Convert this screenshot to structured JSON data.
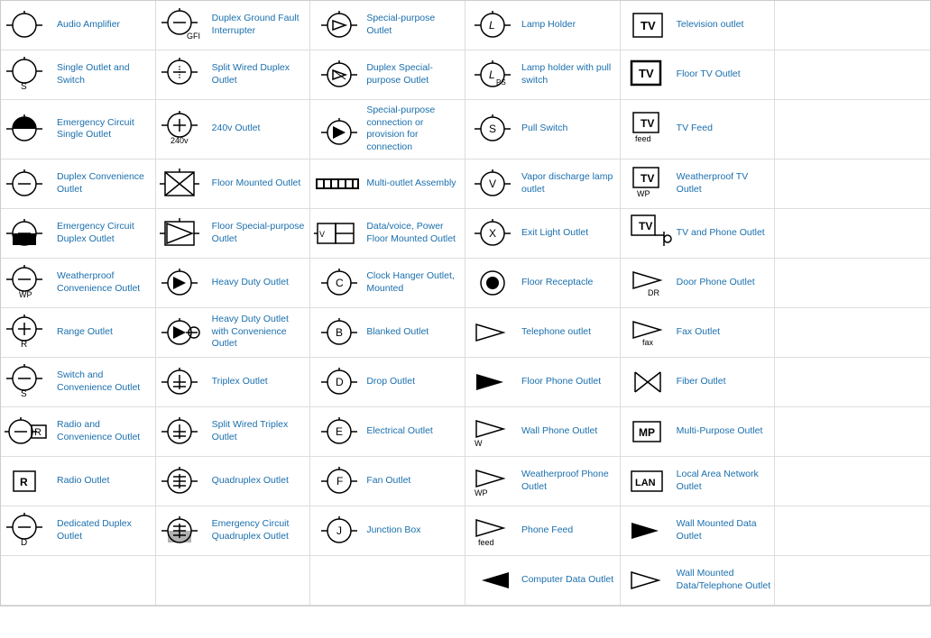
{
  "items": [
    {
      "id": "audio-amplifier",
      "label": "Audio Amplifier",
      "col": 1
    },
    {
      "id": "duplex-gfi",
      "label": "Duplex Ground Fault Interrupter",
      "col": 2
    },
    {
      "id": "special-purpose-outlet",
      "label": "Special-purpose Outlet",
      "col": 3
    },
    {
      "id": "lamp-holder",
      "label": "Lamp Holder",
      "col": 4
    },
    {
      "id": "television-outlet",
      "label": "Television outlet",
      "col": 5
    },
    {
      "id": "blank6",
      "label": "",
      "col": 6
    },
    {
      "id": "single-outlet-switch",
      "label": "Single Outlet and Switch",
      "col": 1
    },
    {
      "id": "split-wired-duplex",
      "label": "Split Wired Duplex Outlet",
      "col": 2
    },
    {
      "id": "duplex-special-purpose",
      "label": "Duplex Special-purpose Outlet",
      "col": 3
    },
    {
      "id": "lamp-holder-pull",
      "label": "Lamp holder with pull switch",
      "col": 4
    },
    {
      "id": "floor-tv-outlet",
      "label": "Floor TV Outlet",
      "col": 5
    },
    {
      "id": "blank12",
      "label": "",
      "col": 6
    },
    {
      "id": "emergency-single",
      "label": "Emergency Circuit Single Outlet",
      "col": 1
    },
    {
      "id": "240v-outlet",
      "label": "240v Outlet",
      "col": 2
    },
    {
      "id": "special-purpose-connection",
      "label": "Special-purpose connection or provision for connection",
      "col": 3
    },
    {
      "id": "pull-switch",
      "label": "Pull Switch",
      "col": 4
    },
    {
      "id": "tv-feed",
      "label": "TV Feed",
      "col": 5
    },
    {
      "id": "blank18",
      "label": "",
      "col": 6
    },
    {
      "id": "duplex-convenience",
      "label": "Duplex Convenience Outlet",
      "col": 1
    },
    {
      "id": "floor-mounted",
      "label": "Floor Mounted Outlet",
      "col": 2
    },
    {
      "id": "multi-outlet-assembly",
      "label": "Multi-outlet Assembly",
      "col": 3
    },
    {
      "id": "vapor-discharge",
      "label": "Vapor discharge lamp outlet",
      "col": 4
    },
    {
      "id": "weatherproof-tv",
      "label": "Weatherproof TV Outlet",
      "col": 5
    },
    {
      "id": "blank24",
      "label": "",
      "col": 6
    },
    {
      "id": "emergency-duplex",
      "label": "Emergency Circuit Duplex Outlet",
      "col": 1
    },
    {
      "id": "floor-special-purpose",
      "label": "Floor Special-purpose Outlet",
      "col": 2
    },
    {
      "id": "data-voice-power",
      "label": "Data/voice, Power Floor Mounted Outlet",
      "col": 3
    },
    {
      "id": "exit-light",
      "label": "Exit Light Outlet",
      "col": 4
    },
    {
      "id": "tv-phone",
      "label": "TV and Phone Outlet",
      "col": 5
    },
    {
      "id": "blank30",
      "label": "",
      "col": 6
    },
    {
      "id": "weatherproof-convenience",
      "label": "Weatherproof Convenience Outlet",
      "col": 1
    },
    {
      "id": "heavy-duty",
      "label": "Heavy Duty Outlet",
      "col": 2
    },
    {
      "id": "clock-hanger",
      "label": "Clock Hanger Outlet, Mounted",
      "col": 3
    },
    {
      "id": "floor-receptacle",
      "label": "Floor Receptacle",
      "col": 4
    },
    {
      "id": "door-phone",
      "label": "Door Phone Outlet",
      "col": 5
    },
    {
      "id": "blank36",
      "label": "",
      "col": 6
    },
    {
      "id": "range-outlet",
      "label": "Range Outlet",
      "col": 1
    },
    {
      "id": "heavy-duty-convenience",
      "label": "Heavy Duty Outlet with Convenience Outlet",
      "col": 2
    },
    {
      "id": "blanked-outlet",
      "label": "Blanked Outlet",
      "col": 3
    },
    {
      "id": "telephone-outlet",
      "label": "Telephone outlet",
      "col": 4
    },
    {
      "id": "fax-outlet",
      "label": "Fax Outlet",
      "col": 5
    },
    {
      "id": "blank42",
      "label": "",
      "col": 6
    },
    {
      "id": "switch-convenience",
      "label": "Switch and Convenience Outlet",
      "col": 1
    },
    {
      "id": "triplex-outlet",
      "label": "Triplex Outlet",
      "col": 2
    },
    {
      "id": "drop-outlet",
      "label": "Drop Outlet",
      "col": 3
    },
    {
      "id": "floor-phone",
      "label": "Floor Phone Outlet",
      "col": 4
    },
    {
      "id": "fiber-outlet",
      "label": "Fiber Outlet",
      "col": 5
    },
    {
      "id": "blank48",
      "label": "",
      "col": 6
    },
    {
      "id": "radio-convenience",
      "label": "Radio and Convenience Outlet",
      "col": 1
    },
    {
      "id": "split-wired-triplex",
      "label": "Split Wired Triplex Outlet",
      "col": 2
    },
    {
      "id": "electrical-outlet",
      "label": "Electrical Outlet",
      "col": 3
    },
    {
      "id": "wall-phone",
      "label": "Wall Phone Outlet",
      "col": 4
    },
    {
      "id": "multi-purpose",
      "label": "Multi-Purpose Outlet",
      "col": 5
    },
    {
      "id": "blank54",
      "label": "",
      "col": 6
    },
    {
      "id": "radio-outlet",
      "label": "Radio Outlet",
      "col": 1
    },
    {
      "id": "quadruplex-outlet",
      "label": "Quadruplex Outlet",
      "col": 2
    },
    {
      "id": "fan-outlet",
      "label": "Fan Outlet",
      "col": 3
    },
    {
      "id": "weatherproof-phone",
      "label": "Weatherproof Phone Outlet",
      "col": 4
    },
    {
      "id": "lan-outlet",
      "label": "Local Area Network Outlet",
      "col": 5
    },
    {
      "id": "blank60",
      "label": "",
      "col": 6
    },
    {
      "id": "dedicated-duplex",
      "label": "Dedicated Duplex Outlet",
      "col": 1
    },
    {
      "id": "emergency-quadruplex",
      "label": "Emergency Circuit Quadruplex Outlet",
      "col": 2
    },
    {
      "id": "junction-box",
      "label": "Junction Box",
      "col": 3
    },
    {
      "id": "phone-feed",
      "label": "Phone Feed",
      "col": 4
    },
    {
      "id": "wall-mounted-data",
      "label": "Wall Mounted Data Outlet",
      "col": 5
    },
    {
      "id": "blank66",
      "label": "",
      "col": 6
    },
    {
      "id": "blank67",
      "label": "",
      "col": 1
    },
    {
      "id": "blank68",
      "label": "",
      "col": 2
    },
    {
      "id": "blank69",
      "label": "",
      "col": 3
    },
    {
      "id": "computer-data",
      "label": "Computer Data Outlet",
      "col": 4
    },
    {
      "id": "wall-mounted-data-telephone",
      "label": "Wall Mounted Data/Telephone Outlet",
      "col": 5
    },
    {
      "id": "blank72",
      "label": "",
      "col": 6
    }
  ]
}
